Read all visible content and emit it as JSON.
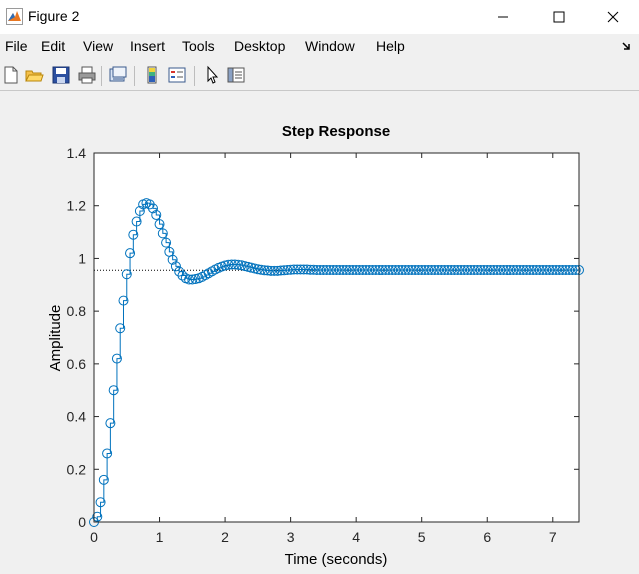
{
  "window": {
    "title": "Figure 2",
    "buttons": [
      "minimize",
      "maximize",
      "close"
    ]
  },
  "menu": {
    "items": [
      "File",
      "Edit",
      "View",
      "Insert",
      "Tools",
      "Desktop",
      "Window",
      "Help"
    ]
  },
  "toolbar": {
    "icons": [
      "new-figure-icon",
      "open-file-icon",
      "save-icon",
      "print-icon",
      "link-plot-icon",
      "insert-colorbar-icon",
      "insert-legend-icon",
      "edit-plot-arrow-icon",
      "property-inspector-icon"
    ]
  },
  "colors": {
    "series": "#0072bd",
    "axis": "#262626",
    "background": "#f0f0f0",
    "plot_bg": "#ffffff",
    "steady_state_line": "#000000"
  },
  "chart_data": {
    "type": "scatter",
    "title": "Step Response",
    "xlabel": "Time (seconds)",
    "ylabel": "Amplitude",
    "xlim": [
      0,
      7.4
    ],
    "ylim": [
      0,
      1.4
    ],
    "xticks": [
      "0",
      "1",
      "2",
      "3",
      "4",
      "5",
      "6",
      "7"
    ],
    "yticks": [
      "0",
      "0.2",
      "0.4",
      "0.6",
      "0.8",
      "1",
      "1.2",
      "1.4"
    ],
    "steady_state": 0.955,
    "marker": "circle",
    "grid": false,
    "series": [
      {
        "x": [
          0,
          0.05,
          0.1,
          0.15,
          0.2,
          0.25,
          0.3,
          0.35,
          0.4,
          0.45,
          0.5,
          0.55,
          0.6,
          0.65,
          0.7,
          0.75,
          0.8,
          0.85,
          0.9,
          0.95,
          1.0,
          1.05,
          1.1,
          1.15,
          1.2,
          1.25,
          1.3,
          1.35,
          1.4,
          1.45,
          1.5,
          1.55,
          1.6,
          1.65,
          1.7,
          1.75,
          1.8,
          1.85,
          1.9,
          1.95,
          2.0,
          2.05,
          2.1,
          2.15,
          2.2,
          2.25,
          2.3,
          2.35,
          2.4,
          2.45,
          2.5,
          2.55,
          2.6,
          2.65,
          2.7,
          2.75,
          2.8,
          2.85,
          2.9,
          2.95,
          3.0,
          3.05,
          3.1,
          3.15,
          3.2,
          3.25,
          3.3,
          3.35,
          3.4,
          3.45,
          3.5,
          3.55,
          3.6,
          3.65,
          3.7,
          3.75,
          3.8,
          3.85,
          3.9,
          3.95,
          4.0,
          4.05,
          4.1,
          4.15,
          4.2,
          4.25,
          4.3,
          4.35,
          4.4,
          4.45,
          4.5,
          4.55,
          4.6,
          4.65,
          4.7,
          4.75,
          4.8,
          4.85,
          4.9,
          4.95,
          5.0,
          5.05,
          5.1,
          5.15,
          5.2,
          5.25,
          5.3,
          5.35,
          5.4,
          5.45,
          5.5,
          5.55,
          5.6,
          5.65,
          5.7,
          5.75,
          5.8,
          5.85,
          5.9,
          5.95,
          6.0,
          6.05,
          6.1,
          6.15,
          6.2,
          6.25,
          6.3,
          6.35,
          6.4,
          6.45,
          6.5,
          6.55,
          6.6,
          6.65,
          6.7,
          6.75,
          6.8,
          6.85,
          6.9,
          6.95,
          7.0,
          7.05,
          7.1,
          7.15,
          7.2,
          7.25,
          7.3,
          7.35,
          7.4
        ],
        "y": [
          0,
          0.02,
          0.075,
          0.16,
          0.26,
          0.375,
          0.5,
          0.62,
          0.735,
          0.84,
          0.94,
          1.02,
          1.09,
          1.14,
          1.18,
          1.205,
          1.21,
          1.205,
          1.19,
          1.165,
          1.13,
          1.095,
          1.06,
          1.025,
          0.995,
          0.97,
          0.95,
          0.935,
          0.925,
          0.92,
          0.92,
          0.922,
          0.925,
          0.93,
          0.937,
          0.944,
          0.951,
          0.958,
          0.964,
          0.969,
          0.973,
          0.976,
          0.977,
          0.977,
          0.976,
          0.974,
          0.971,
          0.968,
          0.965,
          0.962,
          0.959,
          0.957,
          0.955,
          0.954,
          0.953,
          0.953,
          0.953,
          0.954,
          0.955,
          0.956,
          0.957,
          0.958,
          0.958,
          0.958,
          0.958,
          0.958,
          0.957,
          0.957,
          0.956,
          0.956,
          0.956,
          0.956,
          0.956,
          0.956,
          0.956,
          0.956,
          0.956,
          0.956,
          0.956,
          0.956,
          0.956,
          0.956,
          0.956,
          0.956,
          0.956,
          0.956,
          0.956,
          0.956,
          0.956,
          0.956,
          0.956,
          0.956,
          0.956,
          0.956,
          0.956,
          0.956,
          0.956,
          0.956,
          0.956,
          0.956,
          0.956,
          0.956,
          0.956,
          0.956,
          0.956,
          0.956,
          0.956,
          0.956,
          0.956,
          0.956,
          0.956,
          0.956,
          0.956,
          0.956,
          0.956,
          0.956,
          0.956,
          0.956,
          0.956,
          0.956,
          0.956,
          0.956,
          0.956,
          0.956,
          0.956,
          0.956,
          0.956,
          0.956,
          0.956,
          0.956,
          0.956,
          0.956,
          0.956,
          0.956,
          0.956,
          0.956,
          0.956,
          0.956,
          0.956,
          0.956,
          0.956,
          0.956,
          0.956,
          0.956,
          0.956,
          0.956,
          0.956,
          0.956,
          0.956
        ]
      }
    ]
  }
}
